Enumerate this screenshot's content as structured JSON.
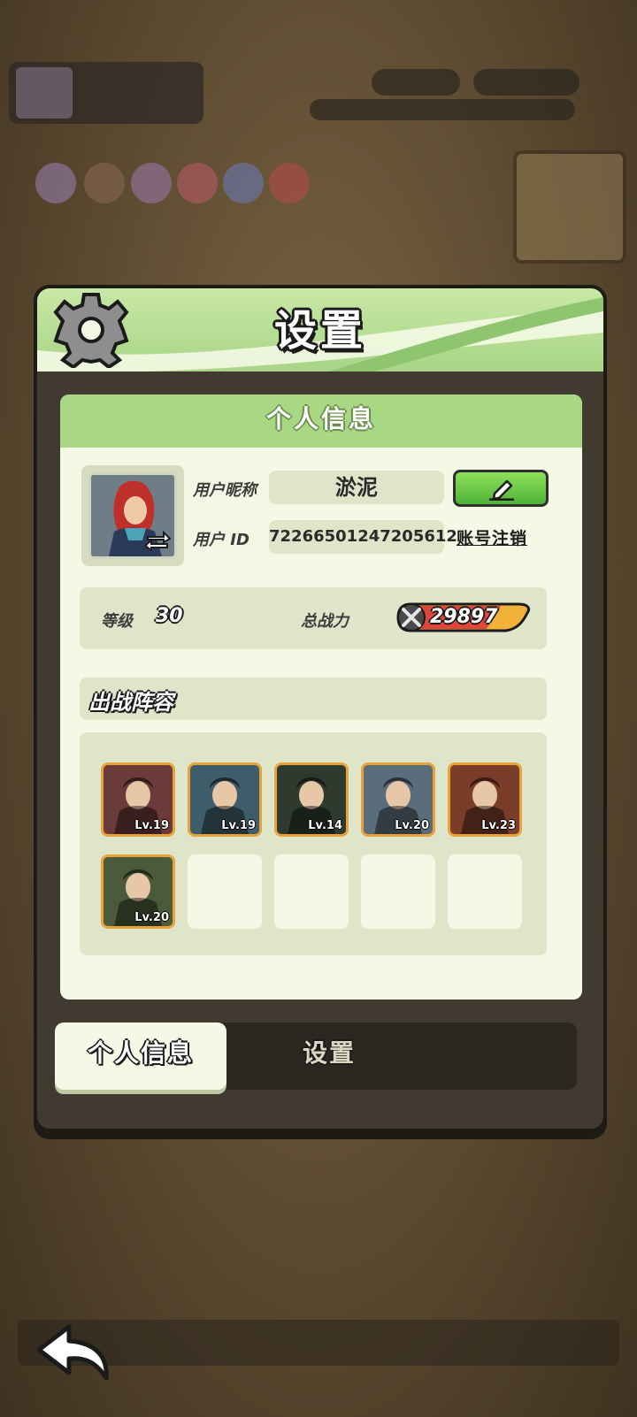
{
  "dialog": {
    "title": "设置",
    "panel_title": "个人信息",
    "nickname_label": "用户昵称",
    "nickname_value": "淤泥",
    "id_label": "用户 ID",
    "id_value": "72266501247205612",
    "account_cancel_label": "账号注销",
    "level_label": "等级",
    "level_value": "30",
    "power_label": "总战力",
    "power_value": "29897",
    "lineup_title": "出战阵容"
  },
  "lineup": [
    {
      "level": "Lv.19",
      "color": "#6b3a3a"
    },
    {
      "level": "Lv.19",
      "color": "#3e5d6a"
    },
    {
      "level": "Lv.14",
      "color": "#2f3a2e"
    },
    {
      "level": "Lv.20",
      "color": "#5a6d7a"
    },
    {
      "level": "Lv.23",
      "color": "#7a3d2a"
    },
    {
      "level": "Lv.20",
      "color": "#4a5a3a"
    }
  ],
  "empty_slots": 4,
  "tabs": [
    {
      "label": "个人信息",
      "active": true
    },
    {
      "label": "设置",
      "active": false
    }
  ],
  "colors": {
    "header_green": "#a9d885",
    "panel_bg": "#f4f8e4",
    "edit_button": "#5cc23d",
    "hero_border": "#e9a23b",
    "power_badge": "#f2b23a"
  }
}
